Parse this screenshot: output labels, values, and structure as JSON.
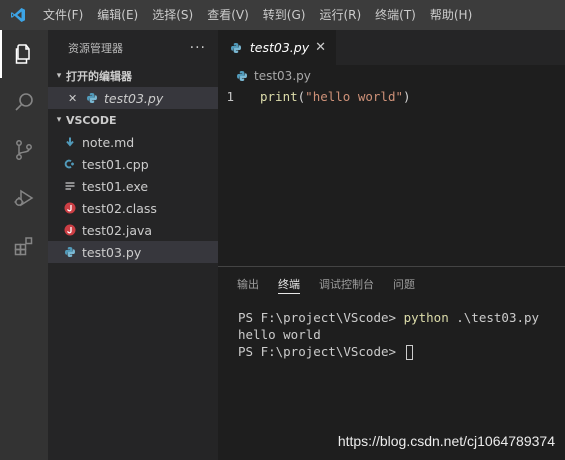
{
  "menu": [
    "文件(F)",
    "编辑(E)",
    "选择(S)",
    "查看(V)",
    "转到(G)",
    "运行(R)",
    "终端(T)",
    "帮助(H)"
  ],
  "sidebar": {
    "title": "资源管理器",
    "more": "···",
    "open_editors": {
      "label": "打开的编辑器",
      "items": [
        {
          "name": "test03.py",
          "close": "✕"
        }
      ]
    },
    "workspace": {
      "label": "VSCODE",
      "files": [
        {
          "name": "note.md",
          "icon": "markdown-icon",
          "color": "#519aba"
        },
        {
          "name": "test01.cpp",
          "icon": "cpp-icon",
          "color": "#519aba"
        },
        {
          "name": "test01.exe",
          "icon": "exe-icon",
          "color": "#cccccc"
        },
        {
          "name": "test02.class",
          "icon": "java-icon",
          "color": "#cc3e44"
        },
        {
          "name": "test02.java",
          "icon": "java-icon",
          "color": "#cc3e44"
        },
        {
          "name": "test03.py",
          "icon": "python-icon",
          "color": "#519aba"
        }
      ]
    }
  },
  "editor": {
    "tab": {
      "label": "test03.py",
      "close": "✕"
    },
    "breadcrumb": "test03.py",
    "line_number": "1",
    "code": {
      "func": "print",
      "open": "(",
      "string": "\"hello world\"",
      "close": ")"
    }
  },
  "panel": {
    "tabs": [
      "输出",
      "终端",
      "调试控制台",
      "问题"
    ],
    "active_tab": "终端",
    "terminal": {
      "prompt1": "PS F:\\project\\VScode> ",
      "command": "python",
      "args": " .\\test03.py",
      "output": "hello world",
      "prompt2": "PS F:\\project\\VScode> "
    }
  },
  "watermark": "https://blog.csdn.net/cj1064789374",
  "colors": {
    "accent": "#007acc",
    "python": "#519aba",
    "java": "#cc3e44"
  }
}
